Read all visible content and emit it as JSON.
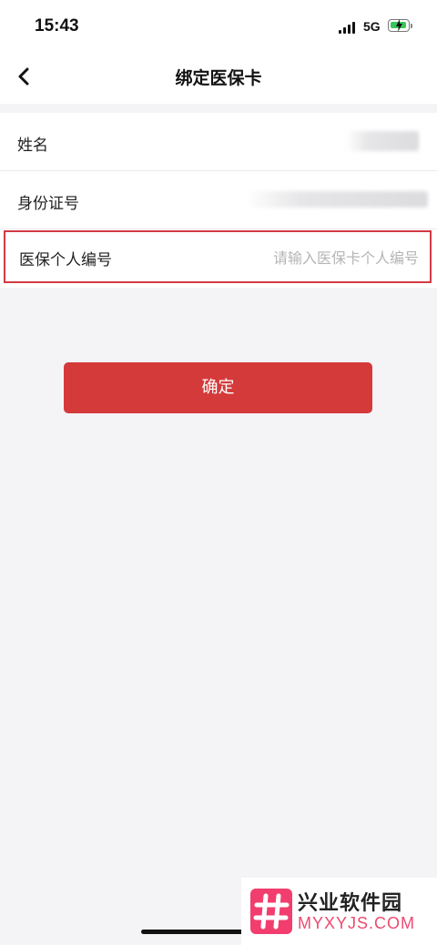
{
  "status_bar": {
    "time": "15:43",
    "network": "5G",
    "battery_icon": "battery-charging-icon",
    "signal_icon": "signal-icon"
  },
  "nav": {
    "back_icon": "chevron-left-icon",
    "title": "绑定医保卡"
  },
  "form": {
    "name_label": "姓名",
    "id_label": "身份证号",
    "insurance_label": "医保个人编号",
    "insurance_placeholder": "请输入医保卡个人编号",
    "insurance_value": ""
  },
  "confirm_label": "确定",
  "watermark": {
    "name": "兴业软件园",
    "domain": "MYXYJS.COM"
  },
  "colors": {
    "accent": "#d43a3a",
    "highlight_border": "#d23a44",
    "page_background": "#f4f4f7",
    "watermark_pink": "#f23e6e"
  }
}
